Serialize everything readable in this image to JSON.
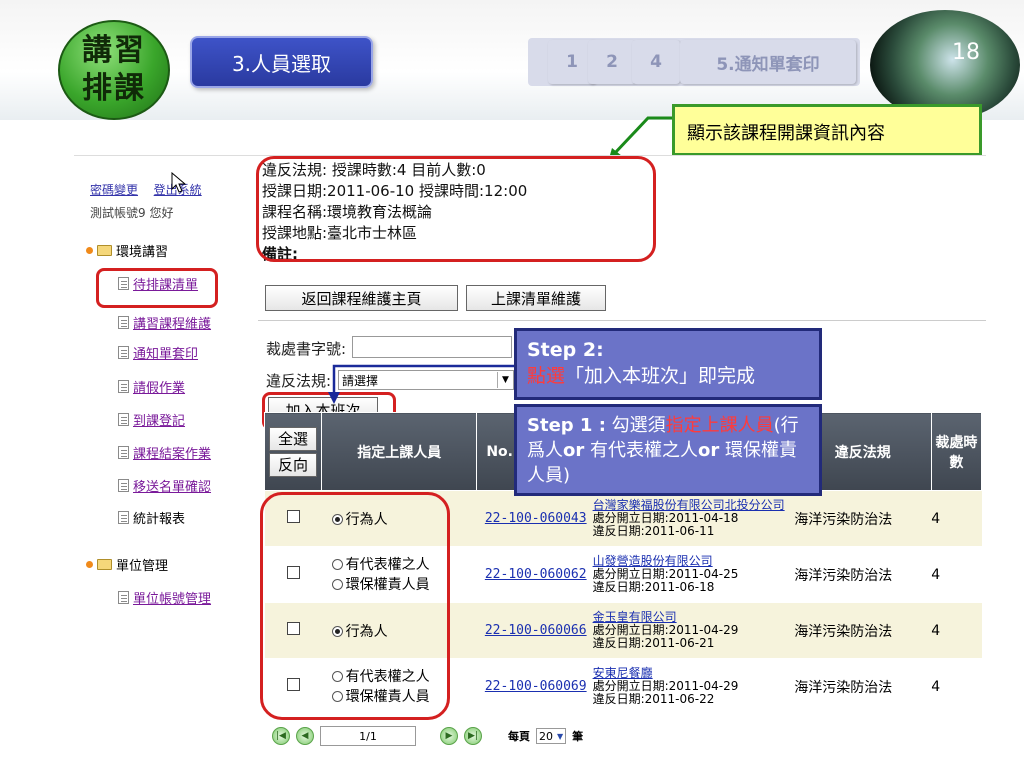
{
  "header": {
    "badge_line1": "講習",
    "badge_line2": "排課",
    "step_title": "3.人員選取",
    "breadcrumbs": [
      "1",
      "2",
      "4",
      "5.通知單套印"
    ],
    "page_number": "18",
    "callout": "顯示該課程開課資訊內容"
  },
  "sidebar": {
    "link_password": "密碼變更",
    "link_logout": "登出系統",
    "greeting": "測試帳號9 您好",
    "groups": [
      {
        "label": "環境講習",
        "items": [
          "待排課清單",
          "講習課程維護",
          "通知單套印",
          "請假作業",
          "到課登記",
          "課程結案作業",
          "移送名單確認",
          "統計報表"
        ]
      },
      {
        "label": "單位管理",
        "items": [
          "單位帳號管理"
        ]
      }
    ]
  },
  "course_info": {
    "line1": "違反法規:  授課時數:4   目前人數:0",
    "line2": "授課日期:2011-06-10   授課時間:12:00",
    "line3": "課程名稱:環境教育法概論",
    "line4": "授課地點:臺北市士林區",
    "line5": "備註:"
  },
  "buttons": {
    "back": "返回課程維護主頁",
    "roster": "上課清單維護",
    "add_class": "加入本班次",
    "select_all": "全選",
    "invert": "反向"
  },
  "filters": {
    "doc_label": "裁處書字號:",
    "law_label": "違反法規:",
    "law_value": "請選擇"
  },
  "steps": {
    "step2_title": "Step 2:",
    "step2_hl": "點選",
    "step2_text": "「加入本班次」即完成",
    "step1_title": "Step 1 :",
    "step1_text_a": " 勾選須",
    "step1_hl": "指定上課人員",
    "step1_text_b": "(行爲人",
    "step1_or1": "or",
    "step1_text_c": " 有代表權之人",
    "step1_or2": "or",
    "step1_text_d": "環保權責人員)"
  },
  "table": {
    "headers": [
      "",
      "指定上課人員",
      "No.",
      "",
      "違反法規",
      "裁處時數"
    ],
    "rows": [
      {
        "type": "single",
        "person": "行為人",
        "case_no": "22-100-060043",
        "company": "台灣家樂福股份有限公司北投分公司",
        "date1": "處分開立日期:2011-04-18",
        "date2": "違反日期:2011-06-11",
        "law": "海洋污染防治法",
        "hours": "4"
      },
      {
        "type": "double",
        "person_a": "有代表權之人",
        "person_b": "環保權責人員",
        "case_no": "22-100-060062",
        "company": "山發營造股份有限公司",
        "date1": "處分開立日期:2011-04-25",
        "date2": "違反日期:2011-06-18",
        "law": "海洋污染防治法",
        "hours": "4"
      },
      {
        "type": "single",
        "person": "行為人",
        "case_no": "22-100-060066",
        "company": "金玉皇有限公司",
        "date1": "處分開立日期:2011-04-29",
        "date2": "違反日期:2011-06-21",
        "law": "海洋污染防治法",
        "hours": "4"
      },
      {
        "type": "double",
        "person_a": "有代表權之人",
        "person_b": "環保權責人員",
        "case_no": "22-100-060069",
        "company": "安東尼餐廳",
        "date1": "處分開立日期:2011-04-29",
        "date2": "違反日期:2011-06-22",
        "law": "海洋污染防治法",
        "hours": "4"
      }
    ]
  },
  "pager": {
    "page": "1",
    "total": "/1",
    "per_page_label": "每頁",
    "per_page_value": "20",
    "unit": "筆"
  }
}
